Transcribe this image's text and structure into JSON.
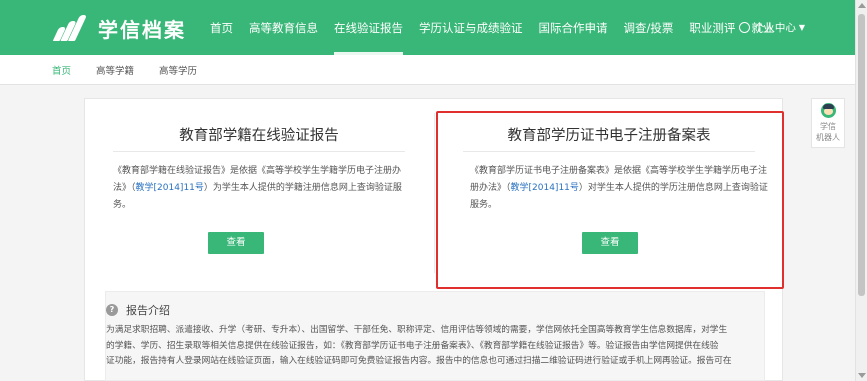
{
  "header": {
    "logo_text": "学信档案",
    "nav": [
      {
        "label": "首页",
        "active": false
      },
      {
        "label": "高等教育信息",
        "active": false
      },
      {
        "label": "在线验证报告",
        "active": true
      },
      {
        "label": "学历认证与成绩验证",
        "active": false
      },
      {
        "label": "国际合作申请",
        "active": false
      },
      {
        "label": "调查/投票",
        "active": false
      },
      {
        "label": "职业测评",
        "active": false
      },
      {
        "label": "就业",
        "active": false
      }
    ],
    "user_center": "个人中心"
  },
  "breadcrumb": {
    "items": [
      "首页",
      "高等学籍",
      "高等学历"
    ]
  },
  "cards": {
    "left": {
      "title": "教育部学籍在线验证报告",
      "line1": "《教育部学籍在线验证报告》是依据《高等学校学生学籍学历电子注册办",
      "line2_pre": "法》（",
      "line2_link": "教学[2014]11号",
      "line2_post": "）为学生本人提供的学籍注册信息网上查询验证服",
      "line3": "务。",
      "button": "查看"
    },
    "right": {
      "title": "教育部学历证书电子注册备案表",
      "line1": "《教育部学历证书电子注册备案表》是依据《高等学校学生学籍学历电子注",
      "line2_pre": "册办法》（",
      "line2_link": "教学[2014]11号",
      "line2_post": "）对学生本人提供的学历注册信息网上查询验证",
      "line3": "服务。",
      "button": "查看"
    }
  },
  "intro": {
    "title": "报告介绍",
    "line1": "为满足求职招聘、派遣接收、升学（考研、专升本）、出国留学、干部任免、职称评定、信用评估等领域的需要，学信网依托全国高等教育学生信息数据库，对学生",
    "line2": "的学籍、学历、招生录取等相关信息提供在线验证报告，如：《教育部学历证书电子注册备案表》、《教育部学籍在线验证报告》等。验证报告由学信网提供在线验",
    "line3": "证功能，报告持有人登录网站在线验证页面，输入在线验证码即可免费验证报告内容。报告中的信息也可通过扫描二维验证码进行验证或手机上网再验证。报告可在"
  },
  "robot": {
    "line1": "学信",
    "line2": "机器人"
  },
  "colors": {
    "brand": "#39b778",
    "highlight": "#e0302d",
    "link": "#2a72c0"
  }
}
